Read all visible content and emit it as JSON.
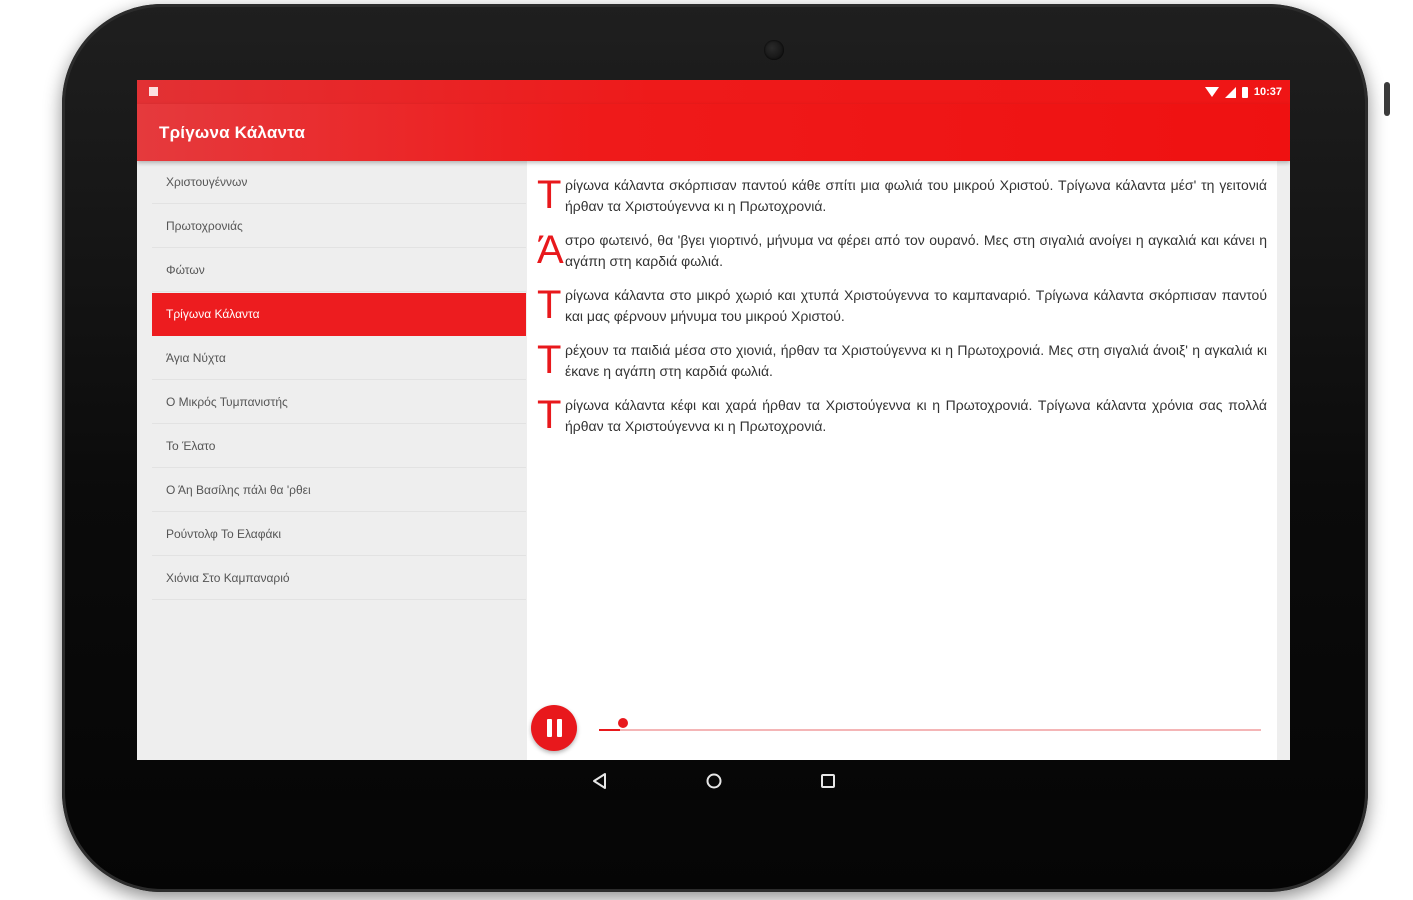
{
  "status_bar": {
    "time": "10:37"
  },
  "app_bar": {
    "title": "Τρίγωνα Κάλαντα"
  },
  "sidebar": {
    "items": [
      {
        "label": "Χριστουγέννων",
        "active": false
      },
      {
        "label": "Πρωτοχρονιάς",
        "active": false
      },
      {
        "label": "Φώτων",
        "active": false
      },
      {
        "label": "Τρίγωνα Κάλαντα",
        "active": true
      },
      {
        "label": "Άγια Νύχτα",
        "active": false
      },
      {
        "label": "Ο Μικρός Τυμπανιστής",
        "active": false
      },
      {
        "label": "Το Έλατο",
        "active": false
      },
      {
        "label": "Ο Άη Βασίλης πάλι θα 'ρθει",
        "active": false
      },
      {
        "label": "Ρούντολφ Το Ελαφάκι",
        "active": false
      },
      {
        "label": "Χιόνια Στο Καμπαναριό",
        "active": false
      }
    ]
  },
  "lyrics": {
    "verses": [
      {
        "cap": "Τ",
        "text": "ρίγωνα κάλαντα σκόρπισαν παντού κάθε σπίτι μια φωλιά του μικρού Χριστού. Τρίγωνα κάλαντα μέσ' τη γειτονιά ήρθαν τα Χριστούγεννα κι η Πρωτοχρονιά."
      },
      {
        "cap": "Ά",
        "text": "στρο φωτεινό, θα 'βγει γιορτινό, μήνυμα να φέρει από τον ουρανό. Μες στη σιγαλιά ανοίγει η αγκαλιά και κάνει η αγάπη στη καρδιά φωλιά."
      },
      {
        "cap": "Τ",
        "text": "ρίγωνα κάλαντα στο μικρό χωριό και χτυπά Χριστούγεννα το καμπαναριό. Τρίγωνα κάλαντα σκόρπισαν παντού και μας φέρνουν μήνυμα του μικρού Χριστού."
      },
      {
        "cap": "Τ",
        "text": "ρέχουν τα παιδιά μέσα στο χιονιά, ήρθαν τα Χριστούγεννα κι η Πρωτοχρονιά. Μες στη σιγαλιά άνοιξ' η αγκαλιά κι έκανε η αγάπη στη καρδιά φωλιά."
      },
      {
        "cap": "Τ",
        "text": "ρίγωνα κάλαντα κέφι και χαρά ήρθαν τα Χριστούγεννα κι η Πρωτοχρονιά. Τρίγωνα κάλαντα χρόνια σας πολλά ήρθαν τα Χριστούγεννα κι η Πρωτοχρονιά."
      }
    ]
  },
  "player": {
    "state": "playing",
    "progress_fraction": 0.02
  },
  "colors": {
    "accent": "#e8181c",
    "app_bar": "#ef1a1a",
    "sidebar_bg": "#eeeeee",
    "content_bg": "#ffffff"
  },
  "icons": {
    "status_left": "notification-icon",
    "wifi": "wifi-icon",
    "signal": "signal-icon",
    "battery": "battery-icon",
    "pause": "pause-icon",
    "back": "back-triangle-icon",
    "home": "home-circle-icon",
    "recents": "recents-square-icon"
  }
}
